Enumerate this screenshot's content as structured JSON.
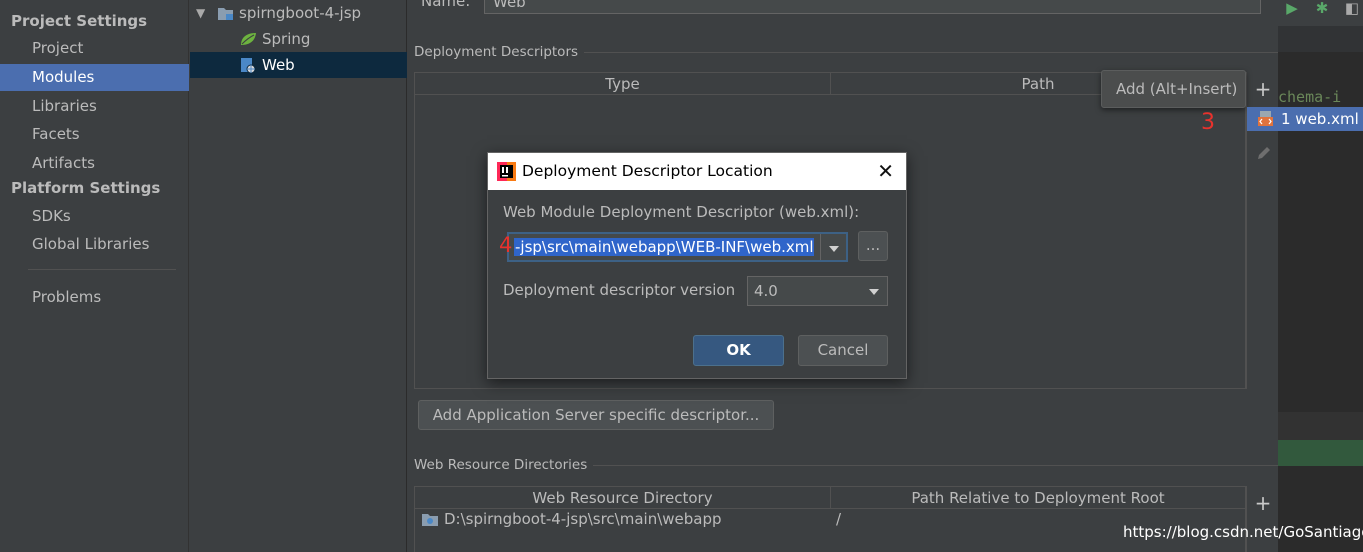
{
  "sidebar": {
    "project_settings_header": "Project Settings",
    "project_items": [
      "Project",
      "Modules",
      "Libraries",
      "Facets",
      "Artifacts"
    ],
    "selected": "Modules",
    "platform_settings_header": "Platform Settings",
    "platform_items": [
      "SDKs",
      "Global Libraries"
    ],
    "problems": "Problems"
  },
  "tree": {
    "root": "spirngboot-4-jsp",
    "children": [
      "Spring",
      "Web"
    ],
    "selected": "Web"
  },
  "panel": {
    "name_label": "Name:",
    "name_value": "Web",
    "deployment_descriptors_title": "Deployment Descriptors",
    "dd_columns": [
      "Type",
      "Path"
    ],
    "add_server_descriptor_button": "Add Application Server specific descriptor...",
    "web_resource_dirs_title": "Web Resource Directories",
    "wr_columns": [
      "Web Resource Directory",
      "Path Relative to Deployment Root"
    ],
    "wr_rows": [
      {
        "directory": "D:\\spirngboot-4-jsp\\src\\main\\webapp",
        "path": "/"
      }
    ]
  },
  "tooltip": {
    "text": "Add (Alt+Insert)"
  },
  "popup": {
    "item": "1  web.xml"
  },
  "annotations": {
    "step3": "3",
    "step4": "4"
  },
  "editor": {
    "code_fragment": "chema-i"
  },
  "dialog": {
    "title": "Deployment Descriptor Location",
    "location_label": "Web Module Deployment Descriptor (web.xml):",
    "location_value": "-jsp\\src\\main\\webapp\\WEB-INF\\web.xml",
    "browse_label": "...",
    "version_label": "Deployment descriptor version",
    "version_value": "4.0",
    "ok_label": "OK",
    "cancel_label": "Cancel"
  },
  "watermark": "https://blog.csdn.net/GoSantiago",
  "colors": {
    "background": "#3c3f41",
    "selection": "#4b6eaf",
    "tree_selection": "#0d293e",
    "annotation_red": "#e8322d",
    "code_green": "#6a8759"
  }
}
